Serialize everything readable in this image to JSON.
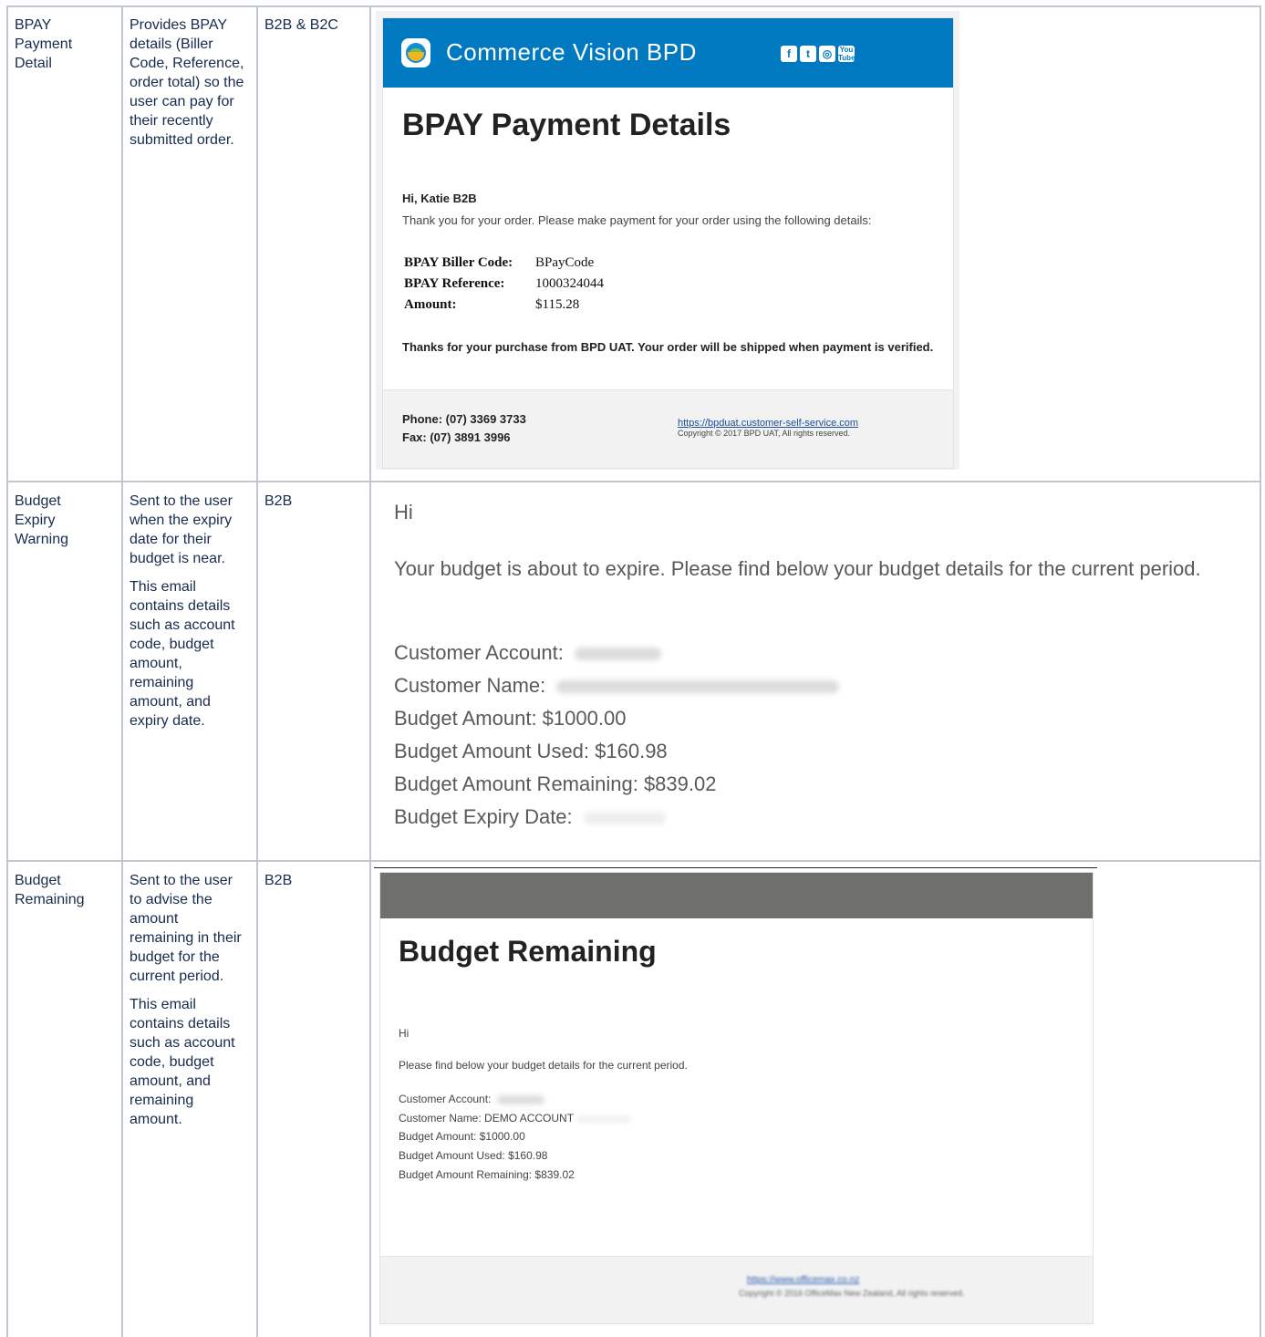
{
  "rows": [
    {
      "name": "BPAY\nPayment\nDetail",
      "description": [
        "Provides BPAY details (Biller Code, Reference, order total) so the user can pay for their recently submitted order."
      ],
      "audience": "B2B & B2C"
    },
    {
      "name": "Budget\nExpiry\nWarning",
      "description": [
        "Sent to the user when the expiry date for their budget is near.",
        "This email contains details such as account code, budget amount, remaining amount, and expiry date."
      ],
      "audience": "B2B"
    },
    {
      "name": "Budget\nRemaining",
      "description": [
        "Sent to the user to advise the amount remaining in their budget for the current period.",
        "This email contains details such as account code, budget amount, and remaining amount."
      ],
      "audience": "B2B"
    }
  ],
  "bpay_email": {
    "brand": "Commerce Vision BPD",
    "social_icons": [
      "facebook-icon",
      "twitter-icon",
      "instagram-icon",
      "youtube-icon"
    ],
    "title": "BPAY Payment Details",
    "greeting": "Hi, Katie B2B",
    "intro": "Thank you for your order. Please make payment for your order using the following details:",
    "details": [
      {
        "label": "BPAY Biller Code:",
        "value": "BPayCode"
      },
      {
        "label": "BPAY Reference:",
        "value": "1000324044"
      },
      {
        "label": "Amount:",
        "value": "$115.28"
      }
    ],
    "shipping_note": "Thanks for your purchase from BPD UAT. Your order will be shipped when payment is verified.",
    "phone": "Phone: (07) 3369 3733",
    "fax": "Fax: (07) 3891 3996",
    "url": "https://bpduat.customer-self-service.com",
    "copyright": "Copyright © 2017 BPD UAT, All rights reserved.",
    "header_color": "#0079c1"
  },
  "expiry_email": {
    "greeting": "Hi",
    "body": "Your budget is about to expire. Please find below your budget details for the current period.",
    "customer_account_label": "Customer Account:",
    "customer_name_label": "Customer Name:",
    "budget_amount": "Budget Amount: $1000.00",
    "budget_used": "Budget Amount Used: $160.98",
    "budget_remaining": "Budget Amount Remaining: $839.02",
    "expiry_label": "Budget Expiry Date:"
  },
  "remaining_email": {
    "title": "Budget Remaining",
    "greeting": "Hi",
    "intro": "Please find below your budget details for the current period.",
    "customer_account_label": "Customer Account:",
    "customer_name": "Customer Name:  DEMO ACCOUNT",
    "budget_amount": "Budget Amount: $1000.00",
    "budget_used": "Budget Amount Used: $160.98",
    "budget_remaining": "Budget Amount Remaining: $839.02",
    "url": "https://www.officemax.co.nz",
    "copyright": "Copyright © 2016 OfficeMax New Zealand, All rights reserved.",
    "header_color": "#6f6f6e"
  }
}
